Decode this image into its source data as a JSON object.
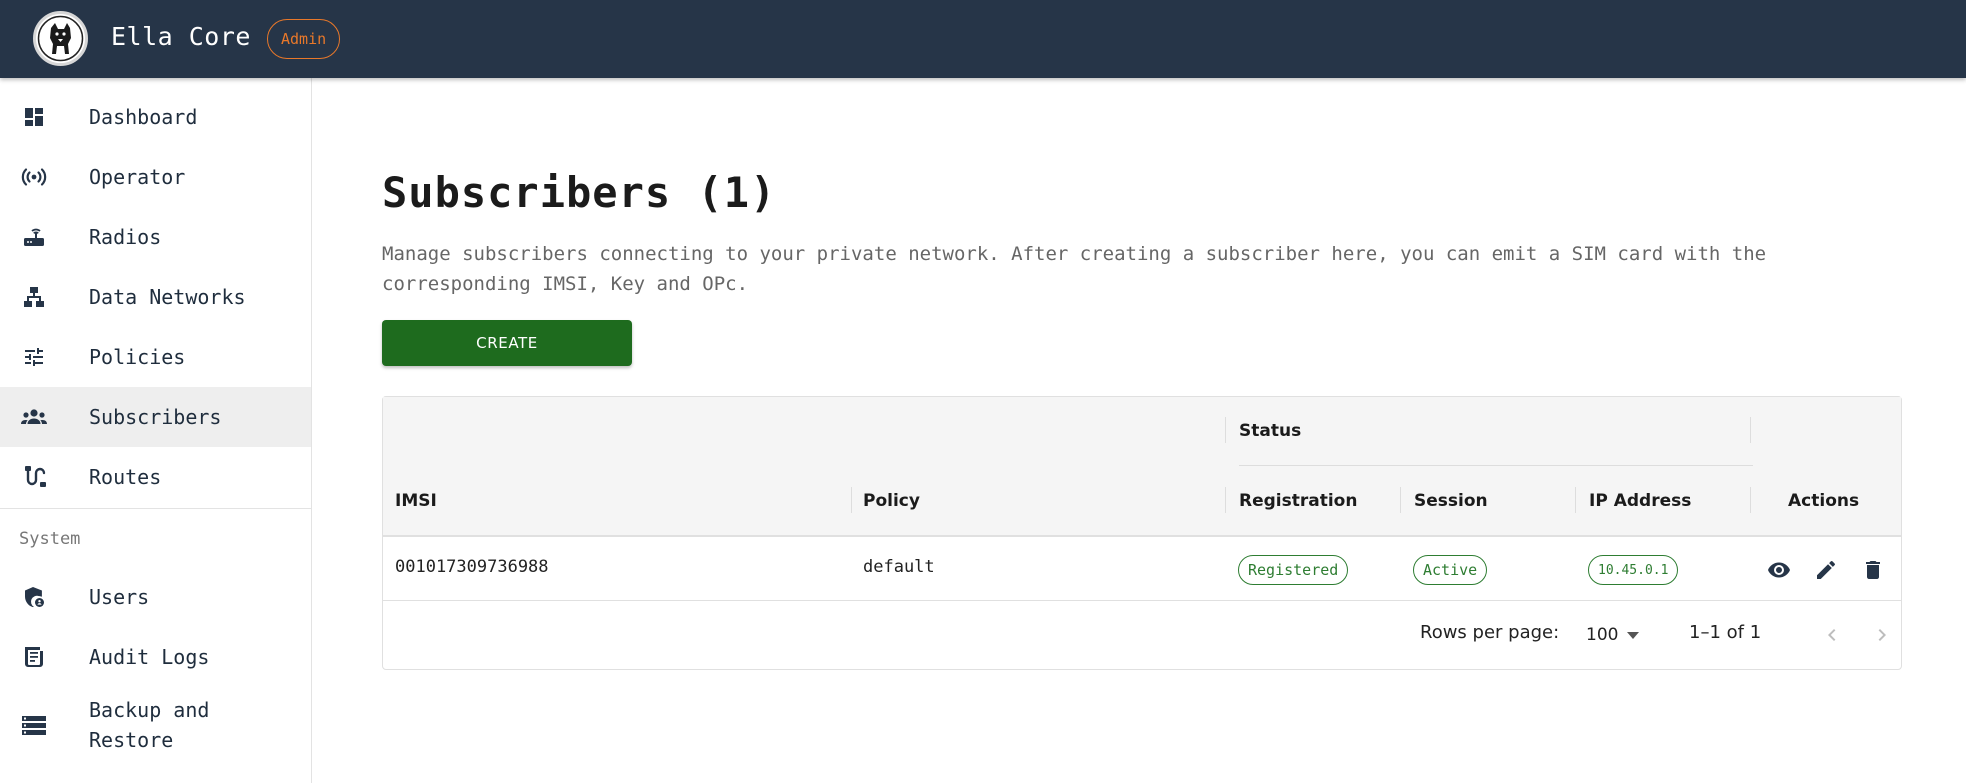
{
  "header": {
    "app_title": "Ella Core",
    "role_badge": "Admin",
    "logo_icon": "dog-logo-icon",
    "background_color": "#263548",
    "badge_color": "#e8782a"
  },
  "sidebar": {
    "items": [
      {
        "label": "Dashboard",
        "icon": "dashboard-icon"
      },
      {
        "label": "Operator",
        "icon": "broadcast-icon"
      },
      {
        "label": "Radios",
        "icon": "router-icon"
      },
      {
        "label": "Data Networks",
        "icon": "network-hierarchy-icon"
      },
      {
        "label": "Policies",
        "icon": "tune-sliders-icon"
      },
      {
        "label": "Subscribers",
        "icon": "people-group-icon",
        "active": true
      },
      {
        "label": "Routes",
        "icon": "route-icon"
      }
    ],
    "system_section_label": "System",
    "system_items": [
      {
        "label": "Users",
        "icon": "admin-shield-icon"
      },
      {
        "label": "Audit Logs",
        "icon": "receipt-log-icon"
      },
      {
        "label": "Backup and Restore",
        "icon": "storage-icon"
      }
    ]
  },
  "main": {
    "title": "Subscribers (1)",
    "description": "Manage subscribers connecting to your private network. After creating a subscriber here, you can emit a SIM card with the corresponding IMSI, Key and OPc.",
    "create_button": "CREATE",
    "accent_color": "#1e6b1e",
    "table": {
      "group_header": "Status",
      "columns": [
        "IMSI",
        "Policy",
        "Registration",
        "Session",
        "IP Address",
        "Actions"
      ],
      "rows": [
        {
          "imsi": "001017309736988",
          "policy": "default",
          "registration": "Registered",
          "session": "Active",
          "ip_address": "10.45.0.1",
          "actions": [
            "view-icon",
            "edit-icon",
            "delete-icon"
          ]
        }
      ],
      "pagination": {
        "rows_per_page_label": "Rows per page:",
        "rows_per_page_value": "100",
        "range_text": "1–1 of 1"
      }
    }
  }
}
